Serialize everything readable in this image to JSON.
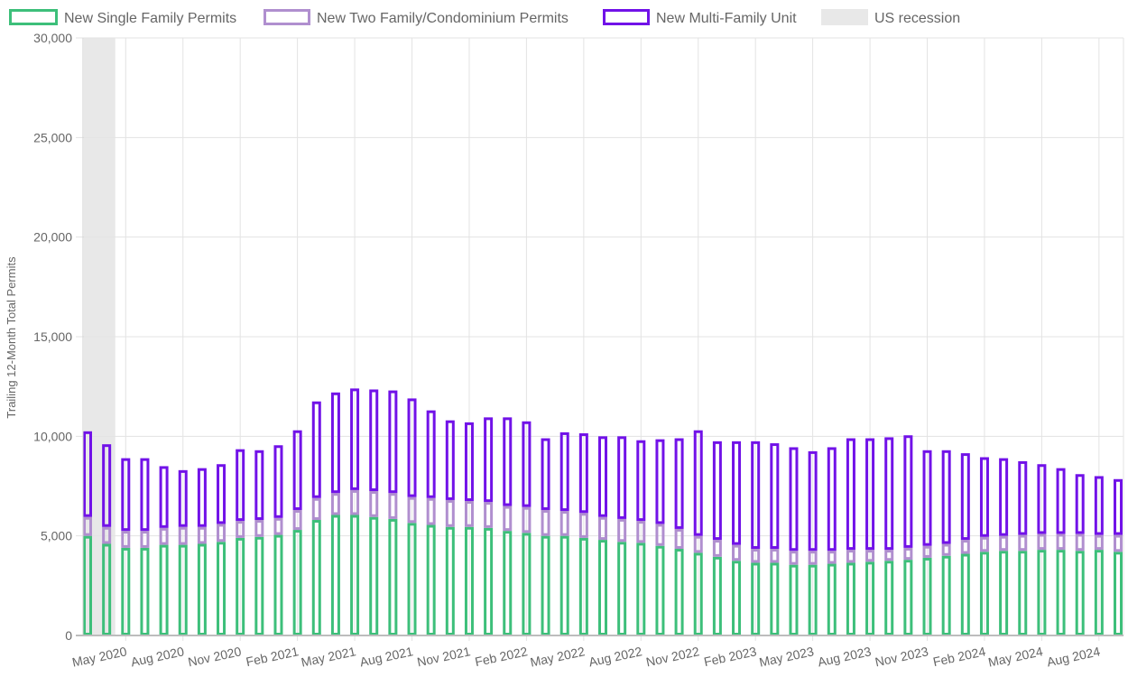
{
  "chart_data": {
    "type": "bar",
    "stacked": true,
    "title": "",
    "xlabel": "",
    "ylabel": "Trailing 12-Month Total Permits",
    "ylim": [
      0,
      30000
    ],
    "y_ticks": [
      0,
      5000,
      10000,
      15000,
      20000,
      25000,
      30000
    ],
    "y_tick_labels": [
      "0",
      "5,000",
      "10,000",
      "15,000",
      "20,000",
      "25,000",
      "30,000"
    ],
    "grid": true,
    "legend_position": "top-left",
    "categories": [
      "Mar 2020",
      "Apr 2020",
      "May 2020",
      "Jun 2020",
      "Jul 2020",
      "Aug 2020",
      "Sep 2020",
      "Oct 2020",
      "Nov 2020",
      "Dec 2020",
      "Jan 2021",
      "Feb 2021",
      "Mar 2021",
      "Apr 2021",
      "May 2021",
      "Jun 2021",
      "Jul 2021",
      "Aug 2021",
      "Sep 2021",
      "Oct 2021",
      "Nov 2021",
      "Dec 2021",
      "Jan 2022",
      "Feb 2022",
      "Mar 2022",
      "Apr 2022",
      "May 2022",
      "Jun 2022",
      "Jul 2022",
      "Aug 2022",
      "Sep 2022",
      "Oct 2022",
      "Nov 2022",
      "Dec 2022",
      "Jan 2023",
      "Feb 2023",
      "Mar 2023",
      "Apr 2023",
      "May 2023",
      "Jun 2023",
      "Jul 2023",
      "Aug 2023",
      "Sep 2023",
      "Oct 2023",
      "Nov 2023",
      "Dec 2023",
      "Jan 2024",
      "Feb 2024",
      "Mar 2024",
      "Apr 2024",
      "May 2024",
      "Jun 2024",
      "Jul 2024",
      "Aug 2024",
      "Sep 2024"
    ],
    "x_tick_labels": [
      {
        "index": 2,
        "label": "May 2020"
      },
      {
        "index": 5,
        "label": "Aug 2020"
      },
      {
        "index": 8,
        "label": "Nov 2020"
      },
      {
        "index": 11,
        "label": "Feb 2021"
      },
      {
        "index": 14,
        "label": "May 2021"
      },
      {
        "index": 17,
        "label": "Aug 2021"
      },
      {
        "index": 20,
        "label": "Nov 2021"
      },
      {
        "index": 23,
        "label": "Feb 2022"
      },
      {
        "index": 26,
        "label": "May 2022"
      },
      {
        "index": 29,
        "label": "Aug 2022"
      },
      {
        "index": 32,
        "label": "Nov 2022"
      },
      {
        "index": 35,
        "label": "Feb 2023"
      },
      {
        "index": 38,
        "label": "May 2023"
      },
      {
        "index": 41,
        "label": "Aug 2023"
      },
      {
        "index": 44,
        "label": "Nov 2023"
      },
      {
        "index": 47,
        "label": "Feb 2024"
      },
      {
        "index": 50,
        "label": "May 2024"
      },
      {
        "index": 53,
        "label": "Aug 2024"
      }
    ],
    "series": [
      {
        "name": "New Single Family Permits",
        "color": "#3dbf7a",
        "values": [
          5000,
          4600,
          4400,
          4400,
          4550,
          4550,
          4600,
          4700,
          4900,
          4950,
          5050,
          5300,
          5800,
          6050,
          6050,
          5950,
          5850,
          5650,
          5550,
          5450,
          5450,
          5400,
          5250,
          5150,
          5000,
          5000,
          4900,
          4800,
          4700,
          4650,
          4500,
          4350,
          4150,
          3950,
          3750,
          3650,
          3650,
          3550,
          3550,
          3600,
          3650,
          3700,
          3750,
          3800,
          3900,
          4000,
          4100,
          4200,
          4250,
          4250,
          4300,
          4300,
          4250,
          4300,
          4200
        ]
      },
      {
        "name": "New Two Family/Condominium Permits",
        "color": "#b08fcf",
        "values": [
          950,
          850,
          850,
          850,
          850,
          900,
          850,
          900,
          850,
          850,
          850,
          1000,
          1100,
          1100,
          1250,
          1300,
          1300,
          1300,
          1350,
          1350,
          1300,
          1300,
          1250,
          1300,
          1300,
          1250,
          1250,
          1150,
          1150,
          1100,
          1100,
          1000,
          850,
          850,
          800,
          700,
          700,
          700,
          700,
          650,
          650,
          600,
          550,
          600,
          600,
          600,
          700,
          750,
          750,
          800,
          800,
          800,
          850,
          750,
          850
        ]
      },
      {
        "name": "New Multi-Family Unit",
        "color": "#7112e8",
        "values": [
          4300,
          4150,
          3650,
          3650,
          3100,
          2850,
          2950,
          3000,
          3600,
          3500,
          3650,
          4000,
          4850,
          5050,
          5100,
          5100,
          5150,
          4950,
          4400,
          4000,
          3950,
          4250,
          4450,
          4300,
          3600,
          3950,
          4000,
          4050,
          4150,
          4050,
          4250,
          4550,
          5300,
          4950,
          5200,
          5400,
          5300,
          5200,
          5000,
          5200,
          5600,
          5600,
          5650,
          5650,
          4800,
          4700,
          4350,
          4000,
          3900,
          3700,
          3500,
          3300,
          3000,
          2950,
          2800
        ]
      },
      {
        "name": "US recession",
        "color": "#e8e8e8",
        "type": "band",
        "x_range": [
          "Mar 2020",
          "Apr 2020"
        ]
      }
    ]
  }
}
